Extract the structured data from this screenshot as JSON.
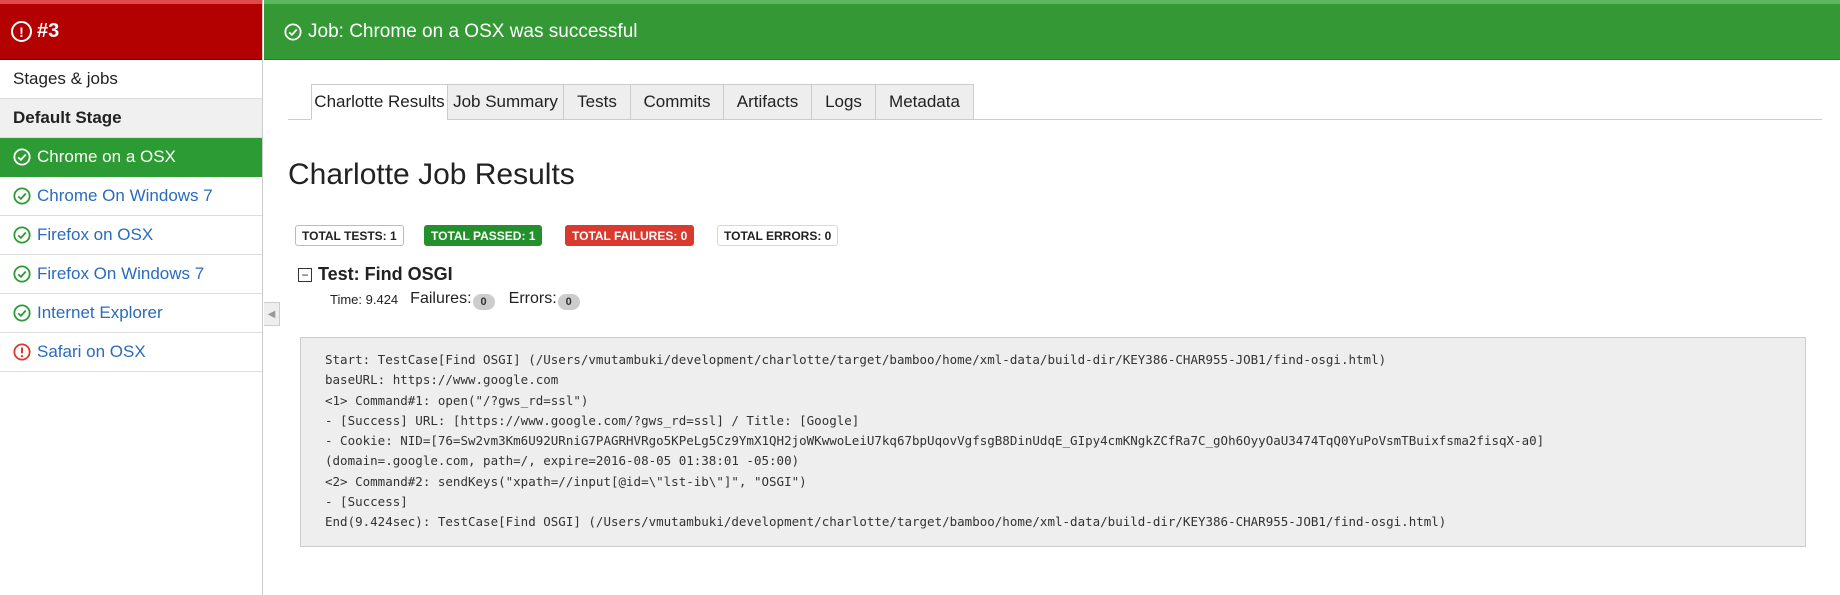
{
  "sidebar": {
    "build_number": "#3",
    "stages_link": "Stages & jobs",
    "stage_name": "Default Stage",
    "jobs": [
      {
        "label": "Chrome on a OSX",
        "status": "success",
        "active": true
      },
      {
        "label": "Chrome On Windows 7",
        "status": "success",
        "active": false
      },
      {
        "label": "Firefox on OSX",
        "status": "success",
        "active": false
      },
      {
        "label": "Firefox On Windows 7",
        "status": "success",
        "active": false
      },
      {
        "label": "Internet Explorer",
        "status": "success",
        "active": false
      },
      {
        "label": "Safari on OSX",
        "status": "failed",
        "active": false
      }
    ]
  },
  "banner": {
    "text": "Job: Chrome on a OSX was successful"
  },
  "tabs": [
    {
      "label": "Charlotte Results",
      "active": true
    },
    {
      "label": "Job Summary",
      "active": false
    },
    {
      "label": "Tests",
      "active": false
    },
    {
      "label": "Commits",
      "active": false
    },
    {
      "label": "Artifacts",
      "active": false
    },
    {
      "label": "Logs",
      "active": false
    },
    {
      "label": "Metadata",
      "active": false
    }
  ],
  "main": {
    "title": "Charlotte Job Results",
    "badges": {
      "total_tests": "TOTAL TESTS: 1",
      "total_passed": "TOTAL PASSED: 1",
      "total_failures": "TOTAL FAILURES: 0",
      "total_errors": "TOTAL ERRORS: 0"
    },
    "test": {
      "toggle": "−",
      "name": "Test: Find OSGI",
      "time": "Time: 9.424",
      "failures_label": "Failures:",
      "failures_count": "0",
      "errors_label": "Errors:",
      "errors_count": "0"
    },
    "log_lines": [
      "Start: TestCase[Find OSGI] (/Users/vmutambuki/development/charlotte/target/bamboo/home/xml-data/build-dir/KEY386-CHAR955-JOB1/find-osgi.html)",
      "baseURL: https://www.google.com",
      "<1> Command#1: open(\"/?gws_rd=ssl\")",
      "- [Success] URL: [https://www.google.com/?gws_rd=ssl] / Title: [Google]",
      "- Cookie: NID=[76=Sw2vm3Km6U92URniG7PAGRHVRgo5KPeLg5Cz9YmX1QH2joWKwwoLeiU7kq67bpUqovVgfsgB8DinUdqE_GIpy4cmKNgkZCfRa7C_gOh6OyyOaU3474TqQ0YuPoVsmTBuixfsma2fisqX-a0]",
      "(domain=.google.com, path=/, expire=2016-08-05 01:38:01 -05:00)",
      "<2> Command#2: sendKeys(\"xpath=//input[@id=\\\"lst-ib\\\"]\", \"OSGI\")",
      "- [Success]",
      "End(9.424sec): TestCase[Find OSGI] (/Users/vmutambuki/development/charlotte/target/bamboo/home/xml-data/build-dir/KEY386-CHAR955-JOB1/find-osgi.html)"
    ]
  },
  "colors": {
    "success": "#349934",
    "failed": "#b30000",
    "link": "#2a6bbd"
  }
}
